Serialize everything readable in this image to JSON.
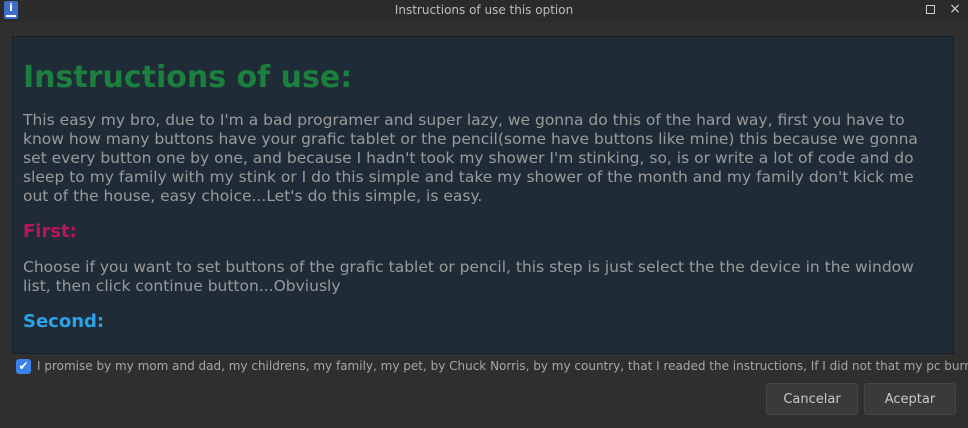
{
  "window": {
    "title": "Instructions of use this option",
    "icon": "info-icon",
    "icon_glyph": "i"
  },
  "content": {
    "heading": "Instructions of use:",
    "intro": "This easy my bro, due to I'm a bad programer and super lazy, we gonna do this of the hard way, first you have to know how many buttons have your grafic tablet or the pencil(some have buttons like mine) this because we gonna set every button one by one, and because I hadn't took my shower I'm stinking, so, is or write a lot of code and do sleep to my family with my stink or I do this simple and take my shower of the month and my family don't kick me out of the house, easy choice...Let's do this simple, is easy.",
    "first_heading": "First:",
    "first_text": "Choose if you want to set buttons of the grafic tablet or pencil, this step is just select the the device in the window list, then click continue button...Obviusly",
    "second_heading": "Second:"
  },
  "promise": {
    "checked": true,
    "label": "I promise by my mom and dad, my childrens, my family, my pet, by Chuck Norris, by my country, that I readed the instructions, If I did not that my pc burn"
  },
  "buttons": {
    "cancel": "Cancelar",
    "accept": "Aceptar"
  },
  "colors": {
    "heading": "#1b7f3e",
    "first_heading": "#c0125c",
    "second_heading": "#2aa3e6",
    "panel_bg": "#1f2c38",
    "checkbox": "#3b82e8"
  }
}
